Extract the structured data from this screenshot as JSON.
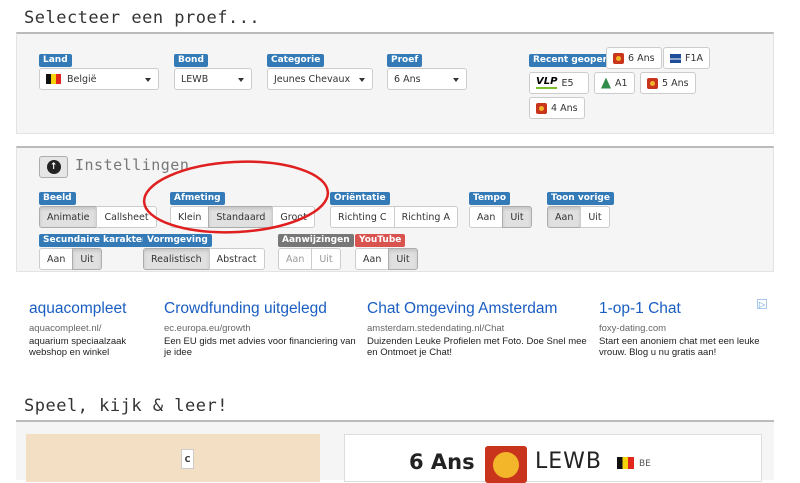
{
  "section1_title": "Selecteer een proef...",
  "filters": {
    "land": {
      "label": "Land",
      "value": "België"
    },
    "bond": {
      "label": "Bond",
      "value": "LEWB"
    },
    "categorie": {
      "label": "Categorie",
      "value": "Jeunes Chevaux"
    },
    "proef": {
      "label": "Proef",
      "value": "6 Ans"
    }
  },
  "recent": {
    "label": "Recent geopend:",
    "items": [
      "6 Ans",
      "F1A",
      "E5",
      "A1",
      "5 Ans",
      "4 Ans"
    ],
    "vlp_logo": "VLP"
  },
  "settings": {
    "title": "Instellingen",
    "beeld": {
      "label": "Beeld",
      "options": [
        "Animatie",
        "Callsheet"
      ]
    },
    "afmeting": {
      "label": "Afmeting",
      "options": [
        "Klein",
        "Standaard",
        "Groot"
      ]
    },
    "orientatie": {
      "label": "Oriëntatie",
      "options": [
        "Richting C",
        "Richting A"
      ]
    },
    "tempo": {
      "label": "Tempo",
      "options": [
        "Aan",
        "Uit"
      ]
    },
    "toon_vorige": {
      "label": "Toon vorige",
      "options": [
        "Aan",
        "Uit"
      ]
    },
    "secundaire": {
      "label": "Secundaire karakters",
      "options": [
        "Aan",
        "Uit"
      ]
    },
    "vormgeving": {
      "label": "Vormgeving",
      "options": [
        "Realistisch",
        "Abstract"
      ]
    },
    "aanwijzingen": {
      "label": "Aanwijzingen",
      "options": [
        "Aan",
        "Uit"
      ]
    },
    "youtube": {
      "label": "YouTube",
      "options": [
        "Aan",
        "Uit"
      ]
    }
  },
  "ads": [
    {
      "title": "aquacompleet",
      "url": "aquacompleet.nl/",
      "desc": "aquarium speciaalzaak webshop en winkel"
    },
    {
      "title": "Crowdfunding uitgelegd",
      "url": "ec.europa.eu/growth",
      "desc": "Een EU gids met advies voor financiering van je idee"
    },
    {
      "title": "Chat Omgeving Amsterdam",
      "url": "amsterdam.stedendating.nl/Chat",
      "desc": "Duizenden Leuke Profielen met Foto. Doe Snel mee en Ontmoet je Chat!"
    },
    {
      "title": "1-op-1 Chat",
      "url": "foxy-dating.com",
      "desc": "Start een anoniem chat met een leuke vrouw. Blog u nu gratis aan!"
    }
  ],
  "section2_title": "Speel, kijk & leer!",
  "preview": {
    "letter": "C",
    "title": "6 Ans",
    "org": "LEWB",
    "country": "BE"
  },
  "colors": {
    "label_blue": "#337ab7",
    "label_red": "#d9534f",
    "label_gray": "#777777",
    "highlight_circle": "#e02020"
  }
}
